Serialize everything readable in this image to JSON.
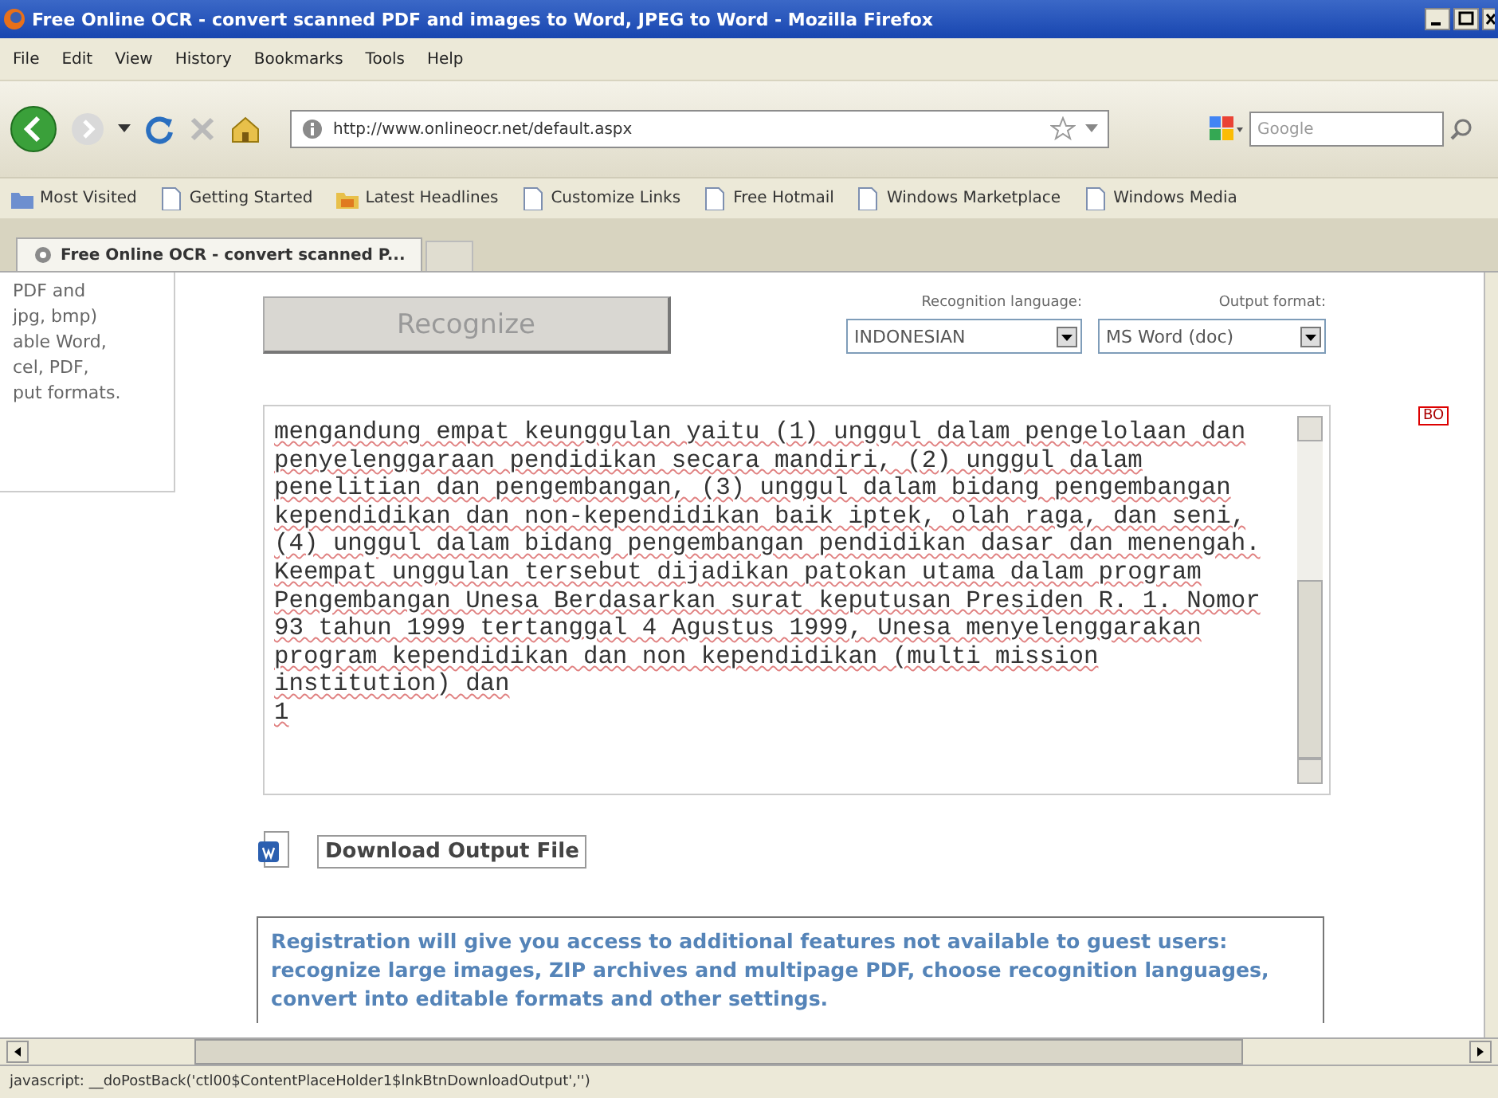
{
  "window": {
    "title": "Free Online OCR - convert scanned PDF and images to Word, JPEG to Word - Mozilla Firefox"
  },
  "menu": [
    "File",
    "Edit",
    "View",
    "History",
    "Bookmarks",
    "Tools",
    "Help"
  ],
  "address_bar": {
    "value": "http://www.onlineocr.net/default.aspx"
  },
  "search": {
    "placeholder": "Google"
  },
  "bookmarks": [
    {
      "label": "Most Visited",
      "kind": "folder"
    },
    {
      "label": "Getting Started",
      "kind": "page"
    },
    {
      "label": "Latest Headlines",
      "kind": "feed"
    },
    {
      "label": "Customize Links",
      "kind": "page"
    },
    {
      "label": "Free Hotmail",
      "kind": "page"
    },
    {
      "label": "Windows Marketplace",
      "kind": "page"
    },
    {
      "label": "Windows Media",
      "kind": "page"
    }
  ],
  "tabs": [
    {
      "label": "Free Online OCR - convert scanned P...",
      "selected": true
    }
  ],
  "sidebar": {
    "text": "PDF and\njpg, bmp)\nable Word,\ncel, PDF,\nput formats."
  },
  "recognize_button": {
    "label": "Recognize",
    "disabled": true
  },
  "language": {
    "label": "Recognition language:",
    "value": "INDONESIAN"
  },
  "format": {
    "label": "Output format:",
    "value": "MS Word (doc)"
  },
  "output_text": "mengandung empat keunggulan yaitu (1) unggul dalam pengelolaan dan\npenyelenggaraan pendidikan secara mandiri, (2) unggul dalam\npenelitian dan pengembangan, (3) unggul dalam bidang pengembangan\nkependidikan dan non-kependidikan baik iptek, olah raga, dan seni,\n(4) unggul dalam bidang pengembangan pendidikan dasar dan menengah.\nKeempat unggulan tersebut dijadikan patokan utama dalam program\nPengembangan Unesa Berdasarkan surat keputusan Presiden R. 1. Nomor\n93 tahun 1999 tertanggal 4 Agustus 1999, Unesa menyelenggarakan\nprogram kependidikan dan non kependidikan (multi mission\ninstitution) dan\n1",
  "download_button": {
    "label": "Download Output File"
  },
  "side_badge": {
    "label": "BO"
  },
  "registration_note": "Registration will give you access to additional features not available to guest users: recognize large images, ZIP archives and multipage PDF, choose recognition languages, convert into editable formats and other settings.",
  "status_bar": {
    "text": "javascript: __doPostBack('ctl00$ContentPlaceHolder1$lnkBtnDownloadOutput','')"
  }
}
